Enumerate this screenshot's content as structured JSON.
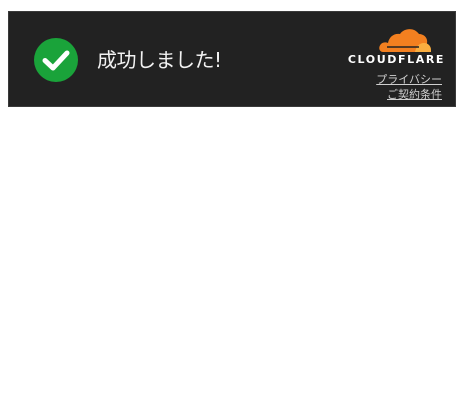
{
  "widget": {
    "status": {
      "text": "成功しました!",
      "icon": "check-circle-icon",
      "color": "#1aa33a"
    },
    "brand": {
      "name": "CLOUDFLARE",
      "logo_icon": "cloudflare-cloud-icon",
      "logo_color": "#f38020",
      "logo_color_light": "#faae40"
    },
    "links": {
      "privacy": "プライバシー",
      "terms": "ご契約条件"
    },
    "background": "#222222"
  }
}
